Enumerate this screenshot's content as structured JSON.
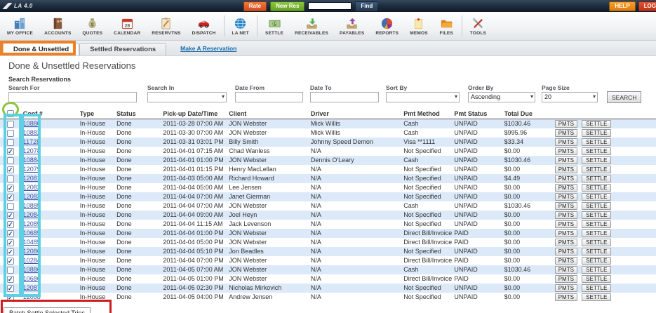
{
  "topbar": {
    "logo": "LA 4.0",
    "rate_label": "Rate",
    "new_res_label": "New Res",
    "find_value": "",
    "find_label": "Find",
    "help_label": "HELP",
    "logout_label": "LOG"
  },
  "toolbar": {
    "items": [
      {
        "label": "MY OFFICE",
        "icon": "office-icon"
      },
      {
        "label": "ACCOUNTS",
        "icon": "accounts-icon"
      },
      {
        "label": "QUOTES",
        "icon": "quotes-icon"
      },
      {
        "label": "CALENDAR",
        "icon": "calendar-icon",
        "day": "28"
      },
      {
        "label": "RESERVTNS",
        "icon": "reservations-icon"
      },
      {
        "label": "DISPATCH",
        "icon": "dispatch-icon"
      },
      {
        "label": "LA NET",
        "icon": "lanet-icon"
      },
      {
        "label": "SETTLE",
        "icon": "settle-icon"
      },
      {
        "label": "RECEIVABLES",
        "icon": "receivables-icon"
      },
      {
        "label": "PAYABLES",
        "icon": "payables-icon"
      },
      {
        "label": "REPORTS",
        "icon": "reports-icon"
      },
      {
        "label": "MEMOS",
        "icon": "memos-icon"
      },
      {
        "label": "FILES",
        "icon": "files-icon"
      },
      {
        "label": "TOOLS",
        "icon": "tools-icon"
      }
    ]
  },
  "tabs": {
    "done_unsettled": "Done & Unsettled",
    "settled": "Settled Reservations",
    "make_reservation": "Make A Reservation"
  },
  "page_title": "Done & Unsettled Reservations",
  "search": {
    "legend": "Search Reservations",
    "search_for_label": "Search For",
    "search_for_value": "",
    "search_in_label": "Search In",
    "search_in_value": "",
    "date_from_label": "Date From",
    "date_from_value": "",
    "date_to_label": "Date To",
    "date_to_value": "",
    "sort_by_label": "Sort By",
    "sort_by_value": "",
    "order_by_label": "Order By",
    "order_by_value": "Ascending",
    "page_size_label": "Page Size",
    "page_size_value": "20",
    "search_button": "SEARCH"
  },
  "table": {
    "headers": {
      "conf": "Conf #",
      "type": "Type",
      "status": "Status",
      "pickup": "Pick-up Date/Time",
      "client": "Client",
      "driver": "Driver",
      "method": "Pmt Method",
      "pstatus": "Pmt Status",
      "total": "Total Due"
    },
    "pmts_label": "PMTS",
    "settle_label": "SETTLE",
    "rows": [
      {
        "conf": "10880",
        "type": "In-House",
        "status": "Done",
        "pickup": "2011-03-28 07:00 AM",
        "client": "JON Webster",
        "driver": "Mick Willis",
        "method": "Cash",
        "pstatus": "UNPAID",
        "total": "$1030.46",
        "checked": false
      },
      {
        "conf": "10882",
        "type": "In-House",
        "status": "Done",
        "pickup": "2011-03-30 07:00 AM",
        "client": "JON Webster",
        "driver": "Mick Willis",
        "method": "Cash",
        "pstatus": "UNPAID",
        "total": "$995.96",
        "checked": false
      },
      {
        "conf": "11728",
        "type": "In-House",
        "status": "Done",
        "pickup": "2011-03-31 03:01 PM",
        "client": "Billy Smith",
        "driver": "Johnny Speed Demon",
        "method": "Visa **1111",
        "pstatus": "UNPAID",
        "total": "$33.34",
        "checked": false
      },
      {
        "conf": "12078",
        "type": "In-House",
        "status": "Done",
        "pickup": "2011-04-01 07:15 AM",
        "client": "Chad Wanless",
        "driver": "N/A",
        "method": "Not Specified",
        "pstatus": "UNPAID",
        "total": "$0.00",
        "checked": true
      },
      {
        "conf": "10884",
        "type": "In-House",
        "status": "Done",
        "pickup": "2011-04-01 01:00 PM",
        "client": "JON Webster",
        "driver": "Dennis O'Leary",
        "method": "Cash",
        "pstatus": "UNPAID",
        "total": "$1030.46",
        "checked": false
      },
      {
        "conf": "12079",
        "type": "In-House",
        "status": "Done",
        "pickup": "2011-04-01 01:15 PM",
        "client": "Henry MacLellan",
        "driver": "N/A",
        "method": "Not Specified",
        "pstatus": "UNPAID",
        "total": "$0.00",
        "checked": true
      },
      {
        "conf": "12081",
        "type": "In-House",
        "status": "Done",
        "pickup": "2011-04-03 05:00 AM",
        "client": "Richard Howard",
        "driver": "N/A",
        "method": "Not Specified",
        "pstatus": "UNPAID",
        "total": "$4.49",
        "checked": false
      },
      {
        "conf": "12082",
        "type": "In-House",
        "status": "Done",
        "pickup": "2011-04-04 05:00 AM",
        "client": "Lee Jensen",
        "driver": "N/A",
        "method": "Not Specified",
        "pstatus": "UNPAID",
        "total": "$0.00",
        "checked": true
      },
      {
        "conf": "12083",
        "type": "In-House",
        "status": "Done",
        "pickup": "2011-04-04 07:00 AM",
        "client": "Janet Gierman",
        "driver": "N/A",
        "method": "Not Specified",
        "pstatus": "UNPAID",
        "total": "$0.00",
        "checked": true
      },
      {
        "conf": "10885",
        "type": "In-House",
        "status": "Done",
        "pickup": "2011-04-04 07:00 AM",
        "client": "JON Webster",
        "driver": "N/A",
        "method": "Cash",
        "pstatus": "UNPAID",
        "total": "$1030.46",
        "checked": false
      },
      {
        "conf": "12084",
        "type": "In-House",
        "status": "Done",
        "pickup": "2011-04-04 09:00 AM",
        "client": "Joel Heyn",
        "driver": "N/A",
        "method": "Not Specified",
        "pstatus": "UNPAID",
        "total": "$0.00",
        "checked": true
      },
      {
        "conf": "12085",
        "type": "In-House",
        "status": "Done",
        "pickup": "2011-04-04 11:15 AM",
        "client": "Jack Levenson",
        "driver": "N/A",
        "method": "Not Specified",
        "pstatus": "UNPAID",
        "total": "$0.00",
        "checked": true
      },
      {
        "conf": "10685",
        "type": "In-House",
        "status": "Done",
        "pickup": "2011-04-04 01:00 PM",
        "client": "JON Webster",
        "driver": "N/A",
        "method": "Direct Bill/Invoice",
        "pstatus": "PAID",
        "total": "$0.00",
        "checked": true
      },
      {
        "conf": "10485",
        "type": "In-House",
        "status": "Done",
        "pickup": "2011-04-04 05:00 PM",
        "client": "JON Webster",
        "driver": "N/A",
        "method": "Direct Bill/Invoice",
        "pstatus": "PAID",
        "total": "$0.00",
        "checked": true
      },
      {
        "conf": "12086",
        "type": "In-House",
        "status": "Done",
        "pickup": "2011-04-04 05:10 PM",
        "client": "Jon Beadles",
        "driver": "N/A",
        "method": "Not Specified",
        "pstatus": "UNPAID",
        "total": "$0.00",
        "checked": true
      },
      {
        "conf": "10284",
        "type": "In-House",
        "status": "Done",
        "pickup": "2011-04-04 07:00 PM",
        "client": "JON Webster",
        "driver": "N/A",
        "method": "Direct Bill/Invoice",
        "pstatus": "PAID",
        "total": "$0.00",
        "checked": true
      },
      {
        "conf": "10886",
        "type": "In-House",
        "status": "Done",
        "pickup": "2011-04-05 07:00 AM",
        "client": "JON Webster",
        "driver": "N/A",
        "method": "Cash",
        "pstatus": "UNPAID",
        "total": "$1030.46",
        "checked": false
      },
      {
        "conf": "10686",
        "type": "In-House",
        "status": "Done",
        "pickup": "2011-04-05 01:00 PM",
        "client": "JON Webster",
        "driver": "N/A",
        "method": "Direct Bill/Invoice",
        "pstatus": "PAID",
        "total": "$0.00",
        "checked": true
      },
      {
        "conf": "12087",
        "type": "In-House",
        "status": "Done",
        "pickup": "2011-04-05 02:30 PM",
        "client": "Nicholas Mirkovich",
        "driver": "N/A",
        "method": "Not Specified",
        "pstatus": "UNPAID",
        "total": "$0.00",
        "checked": true
      },
      {
        "conf": "12088",
        "type": "In-House",
        "status": "Done",
        "pickup": "2011-04-05 04:00 PM",
        "client": "Andrew Jensen",
        "driver": "N/A",
        "method": "Not Specified",
        "pstatus": "UNPAID",
        "total": "$0.00",
        "checked": true
      }
    ]
  },
  "footer": {
    "batch_settle_label": "Batch Settle Selected Trips"
  },
  "annotations": {
    "select_all_circle_color": "#8dc63f",
    "checkbox_column_highlight_color": "#5ed0e4",
    "active_tab_highlight_color": "#f08121",
    "batch_button_highlight_color": "#cf1d1d"
  }
}
